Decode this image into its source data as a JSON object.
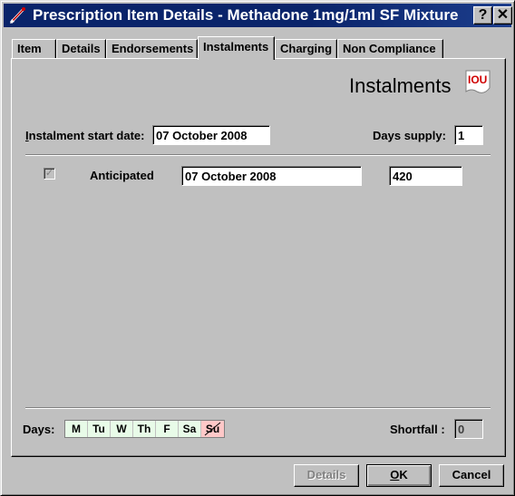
{
  "window": {
    "title": "Prescription Item Details - Methadone 1mg/1ml SF Mixture",
    "help_label": "?",
    "close_label": "✕"
  },
  "tabs": [
    {
      "label": "Item"
    },
    {
      "label": "Details"
    },
    {
      "label": "Endorsements"
    },
    {
      "label": "Instalments",
      "active": true
    },
    {
      "label": "Charging"
    },
    {
      "label": "Non Compliance"
    }
  ],
  "panel": {
    "heading": "Instalments",
    "heading_icon": "iou-icon",
    "start_date_label_underlined": "I",
    "start_date_label_rest": "nstalment start date:",
    "start_date_value": "07 October 2008",
    "days_supply_label": "Days supply:",
    "days_supply_value": "1",
    "anticipated_label": "Anticipated",
    "anticipated_checked": true,
    "anticipated_date": "07 October 2008",
    "anticipated_quantity": "420",
    "days_label": "Days:",
    "days": [
      {
        "label": "M",
        "enabled": true
      },
      {
        "label": "Tu",
        "enabled": true
      },
      {
        "label": "W",
        "enabled": true
      },
      {
        "label": "Th",
        "enabled": true
      },
      {
        "label": "F",
        "enabled": true
      },
      {
        "label": "Sa",
        "enabled": true
      },
      {
        "label": "Su",
        "enabled": false
      }
    ],
    "shortfall_label": "Shortfall :",
    "shortfall_value": "0"
  },
  "buttons": {
    "details": "Details",
    "ok_underlined": "O",
    "ok_rest": "K",
    "cancel": "Cancel"
  },
  "colors": {
    "titlebar": "#0a246a",
    "day_enabled": "#e8fbe8",
    "day_disabled": "#ffc8c8"
  }
}
